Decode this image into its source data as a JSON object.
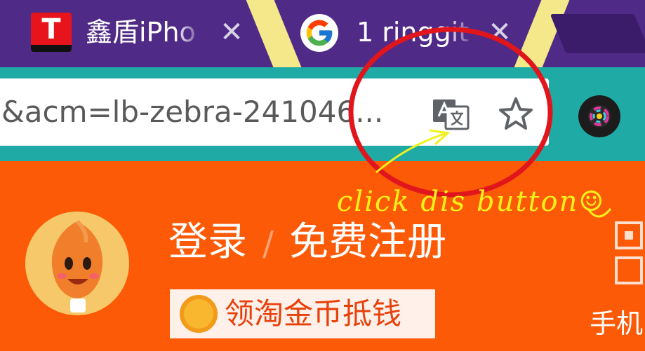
{
  "browser": {
    "tabs": [
      {
        "title": "鑫盾iPho",
        "favicon_letter": "T",
        "favicon": "taobao-t-icon"
      },
      {
        "title": "1 ringgit",
        "favicon": "google-g-icon"
      }
    ],
    "tab_close_glyph": "✕",
    "toolbar": {
      "url": "&acm=lb-zebra-241046...",
      "translate_icon": "translate-icon",
      "bookmark_icon": "star-icon"
    },
    "colors": {
      "tabstrip": "#4f2a86",
      "toolbar": "#20aaa6",
      "page_bg": "#fc5a06"
    }
  },
  "page": {
    "login": "登录",
    "separator": "/",
    "register": "免费注册",
    "coin_label": "领淘金币抵钱",
    "phone_label": "手机"
  },
  "annotation": {
    "text": "click dis button☺",
    "circle_color": "#e0161c",
    "arrow_color": "#f2f21a"
  }
}
